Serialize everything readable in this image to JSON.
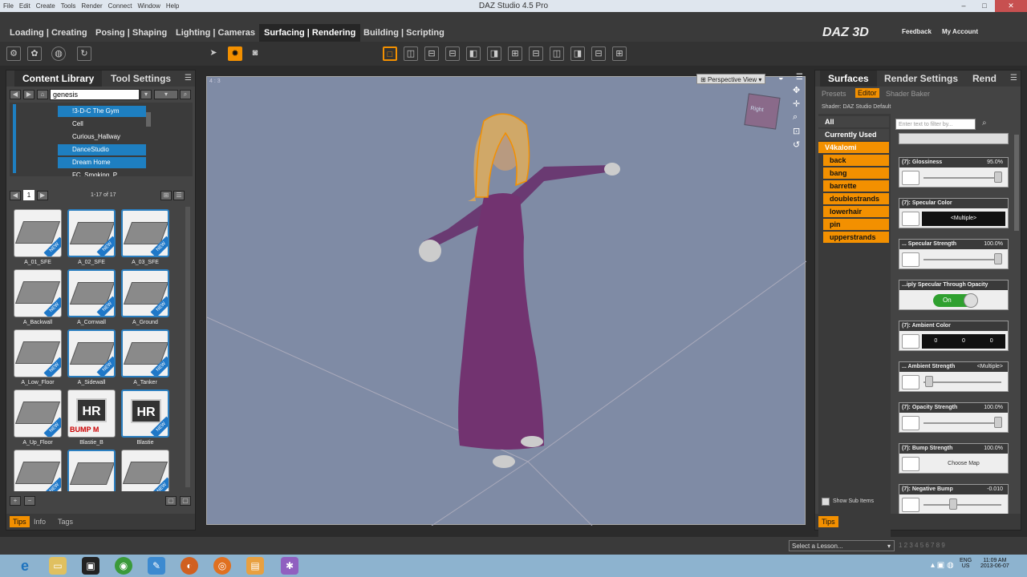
{
  "window": {
    "title": "DAZ Studio 4.5 Pro",
    "controls": [
      "–",
      "□",
      "✕"
    ]
  },
  "menu": [
    "File",
    "Edit",
    "Create",
    "Tools",
    "Render",
    "Connect",
    "Window",
    "Help"
  ],
  "main_tabs": [
    {
      "label": "Loading | Creating",
      "active": false
    },
    {
      "label": "Posing | Shaping",
      "active": false
    },
    {
      "label": "Lighting | Cameras",
      "active": false
    },
    {
      "label": "Surfacing | Rendering",
      "active": true
    },
    {
      "label": "Building | Scripting",
      "active": false
    }
  ],
  "brand": {
    "logo": "DAZ 3D",
    "feedback": "Feedback",
    "account": "My Account"
  },
  "left_panel": {
    "tabs": [
      "Content Library",
      "Tool Settings"
    ],
    "search_value": "genesis",
    "tree_items": [
      {
        "label": "!3-D-C The Gym",
        "selected": true
      },
      {
        "label": "Cell",
        "selected": false
      },
      {
        "label": "Curious_Hallway",
        "selected": false
      },
      {
        "label": "DanceStudio",
        "selected": true
      },
      {
        "label": "Dream Home",
        "selected": true
      },
      {
        "label": "FC_Smoking_P...",
        "selected": false
      }
    ],
    "page": "1",
    "count_text": "1-17 of 17",
    "thumbnails": [
      {
        "label": "A_01_SFE",
        "new": true
      },
      {
        "label": "A_02_SFE",
        "new": true
      },
      {
        "label": "A_03_SFE",
        "new": true
      },
      {
        "label": "A_Backwall",
        "new": true
      },
      {
        "label": "A_Cornwall",
        "new": true
      },
      {
        "label": "A_Ground",
        "new": true
      },
      {
        "label": "A_Low_Floor",
        "new": true
      },
      {
        "label": "A_Sidewall",
        "new": true
      },
      {
        "label": "A_Tanker",
        "new": true
      },
      {
        "label": "A_Up_Floor",
        "new": true
      },
      {
        "label": "Blastie_B",
        "new": false,
        "badge": "HR",
        "badge_sub": "BUMP M"
      },
      {
        "label": "Blastie",
        "new": true,
        "badge": "HR"
      },
      {
        "label": "",
        "new": true
      },
      {
        "label": "",
        "new": false
      },
      {
        "label": "",
        "new": true
      }
    ],
    "bottom_tabs": [
      "Tips",
      "Info",
      "Tags"
    ]
  },
  "viewport": {
    "corner_label": "4 : 3",
    "view_name": "Perspective View",
    "cube_label": "Right"
  },
  "right_panel": {
    "tabs": [
      "Surfaces",
      "Render Settings",
      "Rend"
    ],
    "subtabs": [
      "Presets",
      "Editor",
      "Shader Baker"
    ],
    "shader_label": "Shader: DAZ Studio Default",
    "filter_placeholder": "Enter text to filter by...",
    "categories": [
      "All",
      "Currently Used",
      "V4kalomi",
      "back",
      "bang",
      "barrette",
      "doublestrands",
      "lowerhair",
      "pin",
      "upperstrands"
    ],
    "properties": [
      {
        "title": "(7): Glossiness",
        "value": "95.0%"
      },
      {
        "title": "(7): Specular Color",
        "value": "",
        "field": "<Multiple>"
      },
      {
        "title": "... Specular Strength",
        "value": "100.0%"
      },
      {
        "title": "...iply Specular Through Opacity",
        "value": "",
        "toggle": "On"
      },
      {
        "title": "(7): Ambient Color",
        "value": "",
        "rgb": [
          "0",
          "0",
          "0"
        ]
      },
      {
        "title": "... Ambient Strength",
        "value": "<Multiple>"
      },
      {
        "title": "(7): Opacity Strength",
        "value": "100.0%"
      },
      {
        "title": "(7): Bump Strength",
        "value": "100.0%",
        "field": "Choose Map"
      },
      {
        "title": "(7): Negative Bump",
        "value": "-0.010"
      }
    ],
    "show_sub_items": "Show Sub Items",
    "tips_label": "Tips"
  },
  "statusbar": {
    "lesson_placeholder": "Select a Lesson..."
  },
  "taskbar": {
    "lang": "ENG",
    "region": "US",
    "time": "11:09 AM",
    "date": "2013-06-07"
  }
}
